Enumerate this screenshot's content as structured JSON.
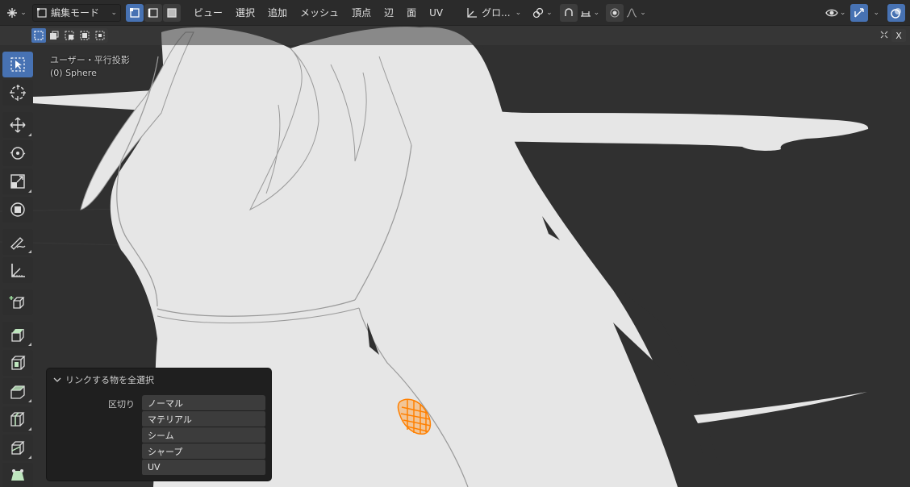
{
  "header": {
    "mode_label": "編集モード",
    "menus": [
      "ビュー",
      "選択",
      "追加",
      "メッシュ",
      "頂点",
      "辺",
      "面",
      "UV"
    ],
    "transform_orientation": "グロ...",
    "icons": [
      "editor-type-icon",
      "mode-icon",
      "vertex-select-icon",
      "edge-select-icon",
      "face-select-icon",
      "transform-orientation-icon",
      "pivot-icon",
      "snap-icon",
      "snap-target-icon",
      "proportional-edit-icon",
      "falloff-icon",
      "visibility-icon",
      "gizmo-icon",
      "overlay-icon"
    ]
  },
  "subheader": {
    "close_label": "X"
  },
  "viewport": {
    "view_name": "ユーザー・平行投影",
    "object_name": "(0) Sphere"
  },
  "toolbar": {
    "tools": [
      "select-box-icon",
      "cursor-icon",
      "move-icon",
      "rotate-icon",
      "scale-icon",
      "transform-icon",
      "annotate-icon",
      "measure-icon",
      "add-cube-icon",
      "extrude-icon",
      "inset-icon",
      "bevel-icon",
      "loop-cut-icon",
      "knife-icon",
      "poly-build-icon"
    ]
  },
  "operator_panel": {
    "title": "リンクする物を全選択",
    "delimit_label": "区切り",
    "options": [
      "ノーマル",
      "マテリアル",
      "シーム",
      "シャープ",
      "UV"
    ]
  },
  "colors": {
    "accent": "#4772b3",
    "selection": "#ff8000",
    "mesh": "#e6e6e6",
    "background": "#303030"
  }
}
